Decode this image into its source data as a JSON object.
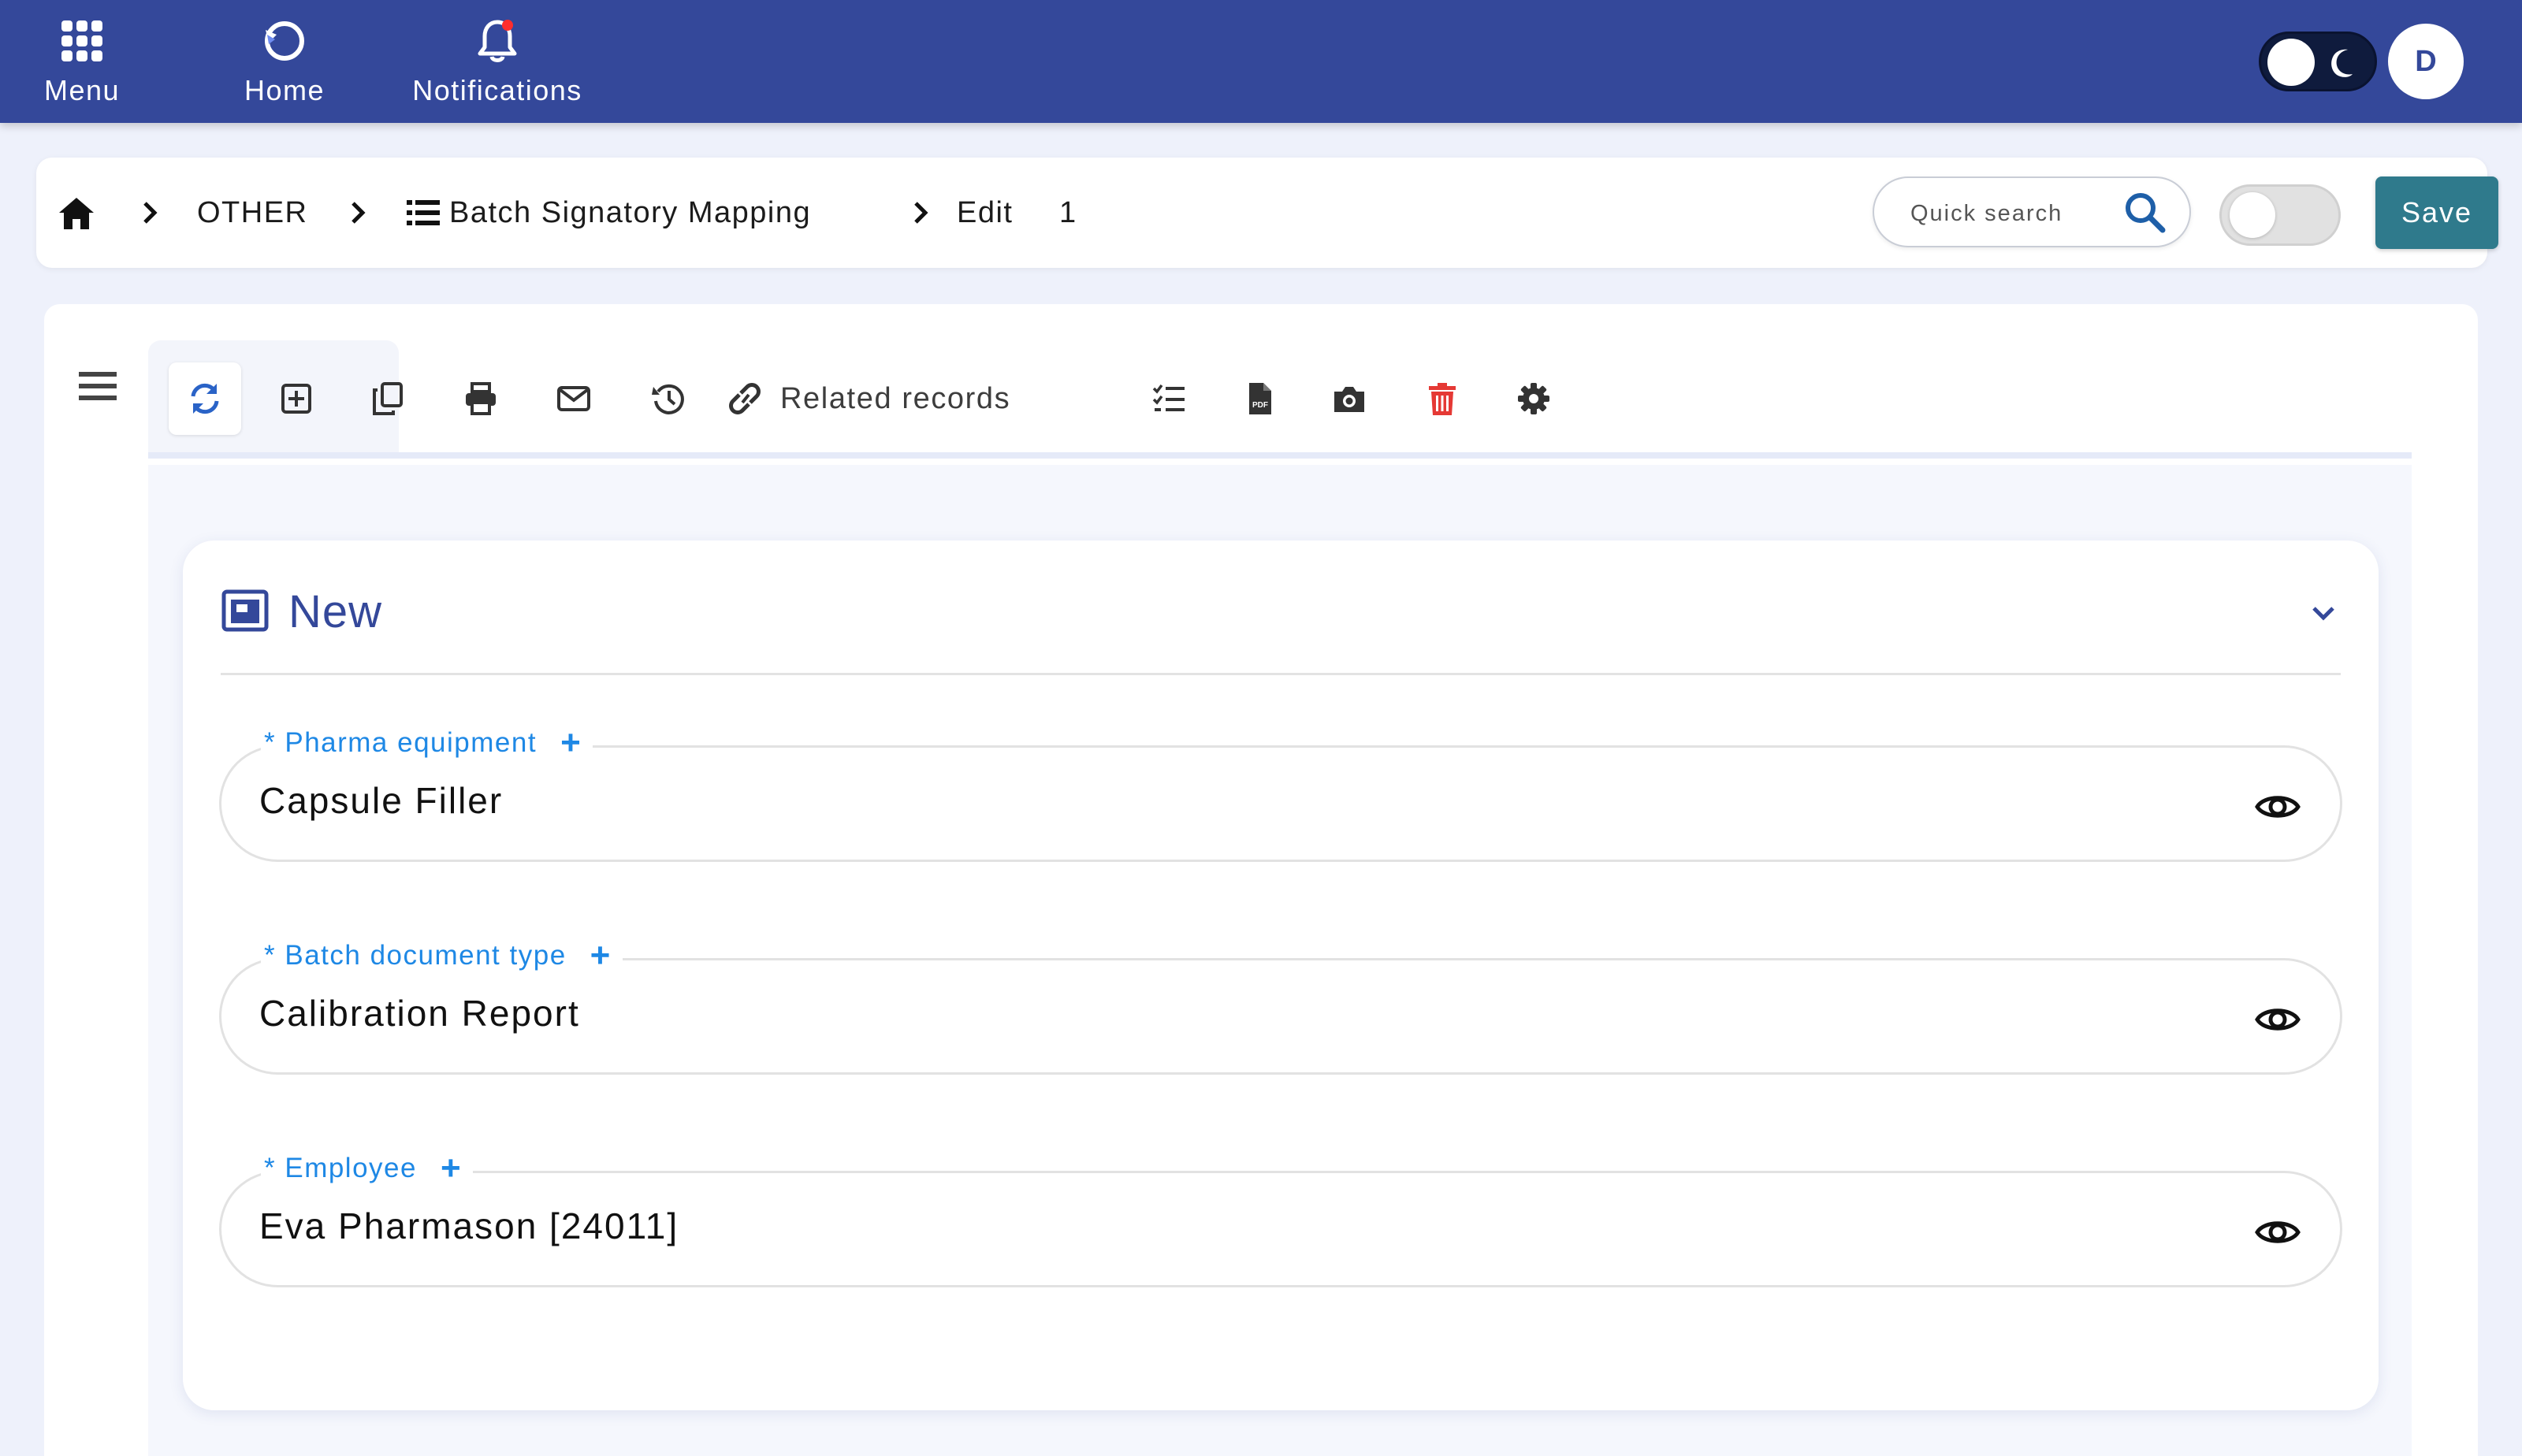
{
  "topnav": {
    "menu_label": "Menu",
    "home_label": "Home",
    "notifications_label": "Notifications",
    "user_initial": "D",
    "theme_mode": "dark"
  },
  "breadcrumb": {
    "section": "OTHER",
    "module": "Batch Signatory Mapping",
    "action": "Edit",
    "record_id": "1"
  },
  "search": {
    "placeholder": "Quick search"
  },
  "save_label": "Save",
  "toolbar": {
    "related_label": "Related records",
    "icons": [
      "refresh-icon",
      "add-icon",
      "copy-icon",
      "print-icon",
      "email-icon",
      "history-icon",
      "link-icon",
      "checklist-icon",
      "pdf-icon",
      "camera-icon",
      "delete-icon",
      "settings-icon"
    ],
    "delete_color": "#e53935"
  },
  "card": {
    "title": "New",
    "fields": [
      {
        "label": "* Pharma equipment",
        "value": "Capsule Filler"
      },
      {
        "label": "* Batch document type",
        "value": "Calibration Report"
      },
      {
        "label": "* Employee",
        "value": "Eva Pharmason [24011]"
      }
    ]
  },
  "colors": {
    "primary": "#34489a",
    "accent_blue": "#1e88e5",
    "save_button": "#2f7a8c"
  }
}
